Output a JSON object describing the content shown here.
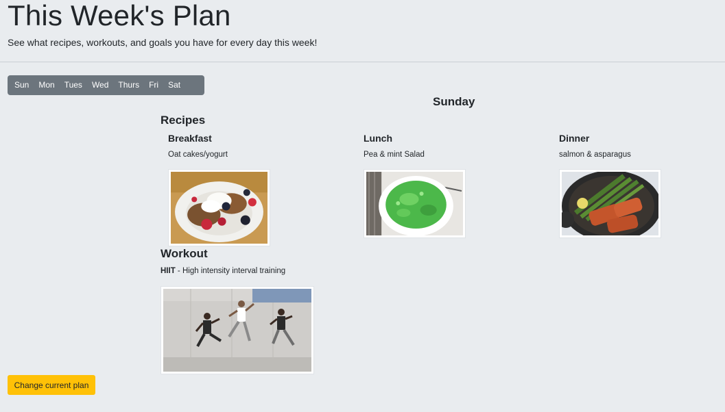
{
  "header": {
    "title": "This Week's Plan",
    "subtitle": "See what recipes, workouts, and goals you have for every day this week!"
  },
  "day_tabs": [
    {
      "label": "Sun"
    },
    {
      "label": "Mon"
    },
    {
      "label": "Tues"
    },
    {
      "label": "Wed"
    },
    {
      "label": "Thurs"
    },
    {
      "label": "Fri"
    },
    {
      "label": "Sat"
    }
  ],
  "selected_day": "Sunday",
  "recipes": {
    "heading": "Recipes",
    "meals": [
      {
        "title": "Breakfast",
        "description": "Oat cakes/yogurt"
      },
      {
        "title": "Lunch",
        "description": "Pea & mint Salad"
      },
      {
        "title": "Dinner",
        "description": "salmon & asparagus"
      }
    ]
  },
  "workout": {
    "heading": "Workout",
    "name": "HIIT",
    "separator": " - ",
    "description": "High intensity interval training"
  },
  "actions": {
    "change_plan_label": "Change current plan"
  }
}
